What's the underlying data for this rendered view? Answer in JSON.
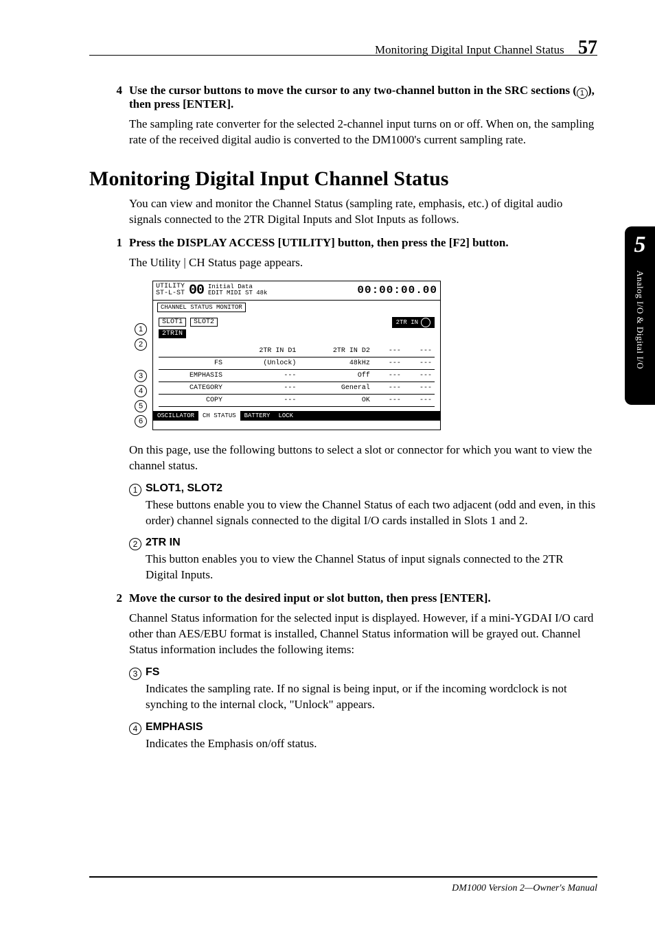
{
  "header": {
    "runningTitle": "Monitoring Digital Input Channel Status",
    "pageNumber": "57"
  },
  "sideTab": {
    "chapter": "5",
    "label": "Analog I/O & Digital I/O"
  },
  "step4": {
    "num": "4",
    "titleA": "Use the cursor buttons to move the cursor to any two-channel button in the SRC sections (",
    "titleCircle": "1",
    "titleB": "), then press [ENTER].",
    "body": "The sampling rate converter for the selected 2-channel input turns on or off. When on, the sampling rate of the received digital audio is converted to the DM1000's current sampling rate."
  },
  "sectionTitle": "Monitoring Digital Input Channel Status",
  "intro": "You can view and monitor the Channel Status (sampling rate, emphasis, etc.) of digital audio signals connected to the 2TR Digital Inputs and Slot Inputs as follows.",
  "step1": {
    "num": "1",
    "title": "Press the DISPLAY ACCESS [UTILITY] button, then press the [F2] button.",
    "body": "The Utility | CH Status page appears."
  },
  "afterFigure": "On this page, use the following buttons to select a slot or connector for which you want to view the channel status.",
  "items": {
    "a": {
      "num": "1",
      "title": "SLOT1, SLOT2",
      "body": "These buttons enable you to view the Channel Status of each two adjacent (odd and even, in this order) channel signals connected to the digital I/O cards installed in Slots 1 and 2."
    },
    "b": {
      "num": "2",
      "title": "2TR IN",
      "body": "This button enables you to view the Channel Status of input signals connected to the 2TR Digital Inputs."
    }
  },
  "step2": {
    "num": "2",
    "title": "Move the cursor to the desired input or slot button, then press [ENTER].",
    "body": "Channel Status information for the selected input is displayed. However, if a mini-YGDAI I/O card other than AES/EBU format is installed, Channel Status information will be grayed out. Channel Status information includes the following items:"
  },
  "items2": {
    "c": {
      "num": "3",
      "title": "FS",
      "body": "Indicates the sampling rate. If no signal is being input, or if the incoming wordclock is not synching to the internal clock, \"Unlock\" appears."
    },
    "d": {
      "num": "4",
      "title": "EMPHASIS",
      "body": "Indicates the Emphasis on/off status."
    }
  },
  "figure": {
    "topUtil1": "UTILITY",
    "topUtil2": "ST-L-ST",
    "big": "00",
    "mid1": "Initial Data",
    "mid2": "EDIT  MIDI ST 48k",
    "tc": "00:00:00.00",
    "bar": "CHANNEL STATUS MONITOR",
    "slot1": "SLOT1",
    "slot2": "SLOT2",
    "trin": "2TRIN",
    "conn": "2TR IN",
    "cols": {
      "c1": "2TR IN D1",
      "c2": "2TR IN D2"
    },
    "rows": {
      "fs": {
        "h": "FS",
        "v1": "(Unlock)",
        "v2": "48kHz",
        "v3": "---",
        "v4": "---"
      },
      "emp": {
        "h": "EMPHASIS",
        "v1": "---",
        "v2": "Off",
        "v3": "---",
        "v4": "---"
      },
      "cat": {
        "h": "CATEGORY",
        "v1": "---",
        "v2": "General",
        "v3": "---",
        "v4": "---"
      },
      "copy": {
        "h": "COPY",
        "v1": "---",
        "v2": "OK",
        "v3": "---",
        "v4": "---"
      }
    },
    "tabs": {
      "t1": "OSCILLATOR",
      "t2": "CH STATUS",
      "t3": "BATTERY",
      "t4": "LOCK"
    },
    "callouts": [
      "1",
      "2",
      "3",
      "4",
      "5",
      "6"
    ]
  },
  "footer": "DM1000 Version 2—Owner's Manual"
}
